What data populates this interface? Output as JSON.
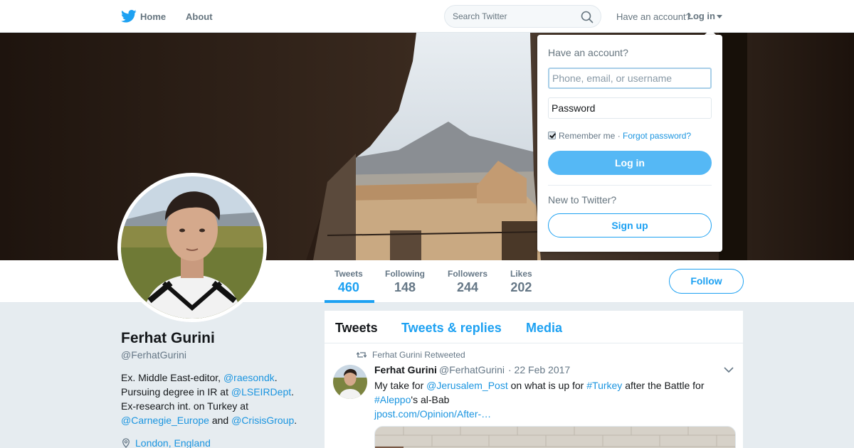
{
  "nav": {
    "home_label": "Home",
    "about_label": "About",
    "search_placeholder": "Search Twitter",
    "have_account": "Have an account?",
    "login_label": "Log in"
  },
  "profile": {
    "name": "Ferhat Gurini",
    "handle": "@FerhatGurini",
    "bio": {
      "t1": "Ex. Middle East-editor, ",
      "l1": "@raesondk",
      "t2": ". Pursuing degree in IR at ",
      "l2": "@LSEIRDept",
      "t3": ". Ex-research int. on Turkey at ",
      "l3": "@Carnegie_Europe",
      "t4": " and ",
      "l4": "@CrisisGroup",
      "t5": "."
    },
    "location": "London, England"
  },
  "stats": [
    {
      "label": "Tweets",
      "value": "460"
    },
    {
      "label": "Following",
      "value": "148"
    },
    {
      "label": "Followers",
      "value": "244"
    },
    {
      "label": "Likes",
      "value": "202"
    }
  ],
  "follow_label": "Follow",
  "timeline": {
    "tabs": [
      "Tweets",
      "Tweets & replies",
      "Media"
    ],
    "tweet": {
      "retweeted_by": "Ferhat Gurini Retweeted",
      "name": "Ferhat Gurini",
      "handle": "@FerhatGurini",
      "date": "· 22 Feb 2017",
      "text": {
        "t1": "My take for ",
        "l1": "@Jerusalem_Post",
        "t2": " on what is up for ",
        "l2": "#Turkey",
        "t3": " after the Battle for ",
        "l3": "#Aleppo",
        "t4": "'s al-Bab",
        "link": "jpost.com/Opinion/After-…"
      }
    }
  },
  "login_dropdown": {
    "title": "Have an account?",
    "username_placeholder": "Phone, email, or username",
    "password_placeholder": "Password",
    "remember_label": "Remember me",
    "separator": "·",
    "forgot_label": "Forgot password?",
    "login_button": "Log in",
    "new_label": "New to Twitter?",
    "signup_button": "Sign up"
  },
  "colors": {
    "accent": "#1da1f2",
    "link": "#1b95e0",
    "background": "#e6ecf0"
  }
}
